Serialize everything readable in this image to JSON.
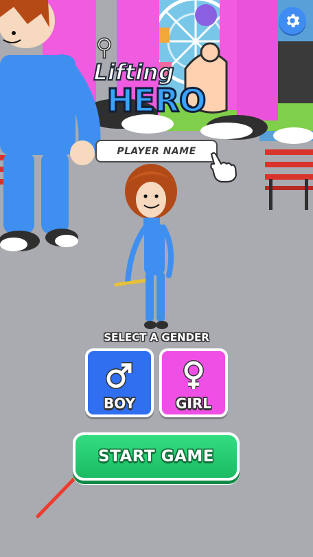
{
  "logo": {
    "line1": "Lifting",
    "line2": "HERO"
  },
  "player_name": {
    "placeholder": "PLAYER NAME"
  },
  "gender": {
    "label": "SELECT A GENDER",
    "boy_label": "BOY",
    "girl_label": "GIRL",
    "boy_color": "#2f6ff0",
    "girl_color": "#f04fe6"
  },
  "start_button": {
    "label": "START GAME",
    "color": "#22c96b"
  },
  "icons": {
    "settings": "gear-icon",
    "logo_emblem": "gender-symbol-icon",
    "tap_hint": "pointing-hand-icon",
    "boy": "male-symbol-icon",
    "girl": "female-symbol-icon",
    "pointer": "red-arrow-icon"
  }
}
